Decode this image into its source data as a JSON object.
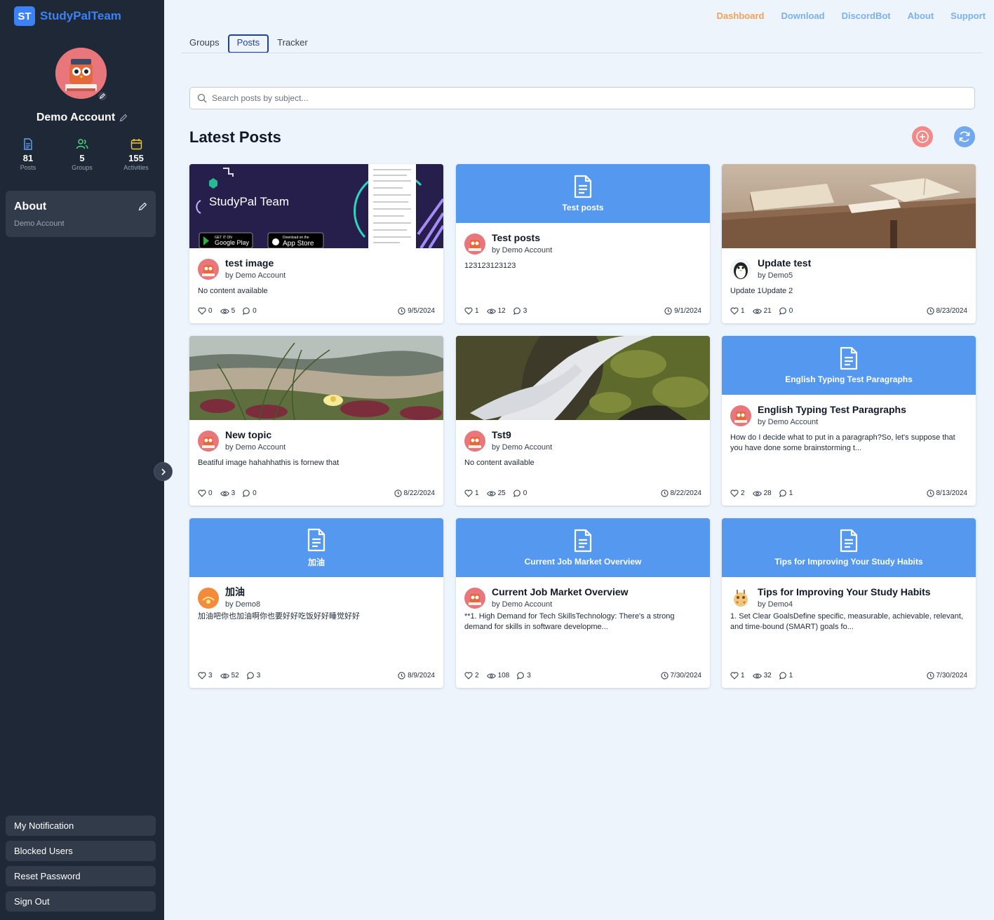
{
  "brand": {
    "logo_text": "ST",
    "name": "StudyPalTeam"
  },
  "profile": {
    "name": "Demo Account",
    "stats": [
      {
        "value": "81",
        "label": "Posts",
        "icon": "document-icon",
        "color": "#60a5fa"
      },
      {
        "value": "5",
        "label": "Groups",
        "icon": "users-icon",
        "color": "#4ade80"
      },
      {
        "value": "155",
        "label": "Activities",
        "icon": "calendar-icon",
        "color": "#facc15"
      }
    ]
  },
  "about": {
    "title": "About",
    "subtitle": "Demo Account"
  },
  "sidebar_buttons": [
    "My Notification",
    "Blocked Users",
    "Reset Password",
    "Sign Out"
  ],
  "topnav": [
    "Dashboard",
    "Download",
    "DiscordBot",
    "About",
    "Support"
  ],
  "tabs": [
    "Groups",
    "Posts",
    "Tracker"
  ],
  "search": {
    "placeholder": "Search posts by subject..."
  },
  "heading": "Latest Posts",
  "colors": {
    "sidebar": "#1f2837",
    "accent": "#3b82f6",
    "banner": "#5598f0",
    "active_nav": "#f2a156"
  },
  "posts": [
    {
      "title": "test image",
      "author": "by Demo Account",
      "content": "No content available",
      "likes": "0",
      "views": "5",
      "comments": "0",
      "date": "9/5/2024",
      "media": "image-studypal",
      "banner_title": "",
      "avatar": "owl-avatar",
      "image_text": {
        "title": "StudyPal Team",
        "badge_google_small": "GET IT ON",
        "badge_google": "Google Play",
        "badge_apple_small": "Download on the",
        "badge_apple": "App Store"
      }
    },
    {
      "title": "Test posts",
      "author": "by Demo Account",
      "content": "123123123123",
      "likes": "1",
      "views": "12",
      "comments": "3",
      "date": "9/1/2024",
      "media": "banner",
      "banner_title": "Test posts",
      "avatar": "owl-avatar"
    },
    {
      "title": "Update test",
      "author": "by Demo5",
      "content": "Update 1Update 2",
      "likes": "1",
      "views": "21",
      "comments": "0",
      "date": "8/23/2024",
      "media": "image-books",
      "banner_title": "",
      "avatar": "penguin-avatar"
    },
    {
      "title": "New topic",
      "author": "by Demo Account",
      "content": "Beatiful image hahahhathis is fornew that",
      "likes": "0",
      "views": "3",
      "comments": "0",
      "date": "8/22/2024",
      "media": "image-flower",
      "banner_title": "",
      "avatar": "owl-avatar"
    },
    {
      "title": "Tst9",
      "author": "by Demo Account",
      "content": "No content available",
      "likes": "1",
      "views": "25",
      "comments": "0",
      "date": "8/22/2024",
      "media": "image-waterfall",
      "banner_title": "",
      "avatar": "owl-avatar"
    },
    {
      "title": "English Typing Test Paragraphs",
      "author": "by Demo Account",
      "content": "How do I decide what to put in a paragraph?So, let's suppose that you have done some brainstorming t...",
      "likes": "2",
      "views": "28",
      "comments": "1",
      "date": "8/13/2024",
      "media": "banner",
      "banner_title": "English Typing Test Paragraphs",
      "avatar": "owl-avatar"
    },
    {
      "title": "加油",
      "author": "by Demo8",
      "content": "加油吧你也加油啊你也要好好吃饭好好睡觉好好",
      "likes": "3",
      "views": "52",
      "comments": "3",
      "date": "8/9/2024",
      "media": "banner",
      "banner_title": "加油",
      "avatar": "orange-avatar"
    },
    {
      "title": "Current Job Market Overview",
      "author": "by Demo Account",
      "content": "**1. High Demand for Tech SkillsTechnology: There's a strong demand for skills in software developme...",
      "likes": "2",
      "views": "108",
      "comments": "3",
      "date": "7/30/2024",
      "media": "banner",
      "banner_title": "Current Job Market Overview",
      "avatar": "owl-avatar"
    },
    {
      "title": "Tips for Improving Your Study Habits",
      "author": "by Demo4",
      "content": "1. Set Clear GoalsDefine specific, measurable, achievable, relevant, and time-bound (SMART) goals fo...",
      "likes": "1",
      "views": "32",
      "comments": "1",
      "date": "7/30/2024",
      "media": "banner",
      "banner_title": "Tips for Improving Your Study Habits",
      "avatar": "giraffe-avatar"
    }
  ]
}
